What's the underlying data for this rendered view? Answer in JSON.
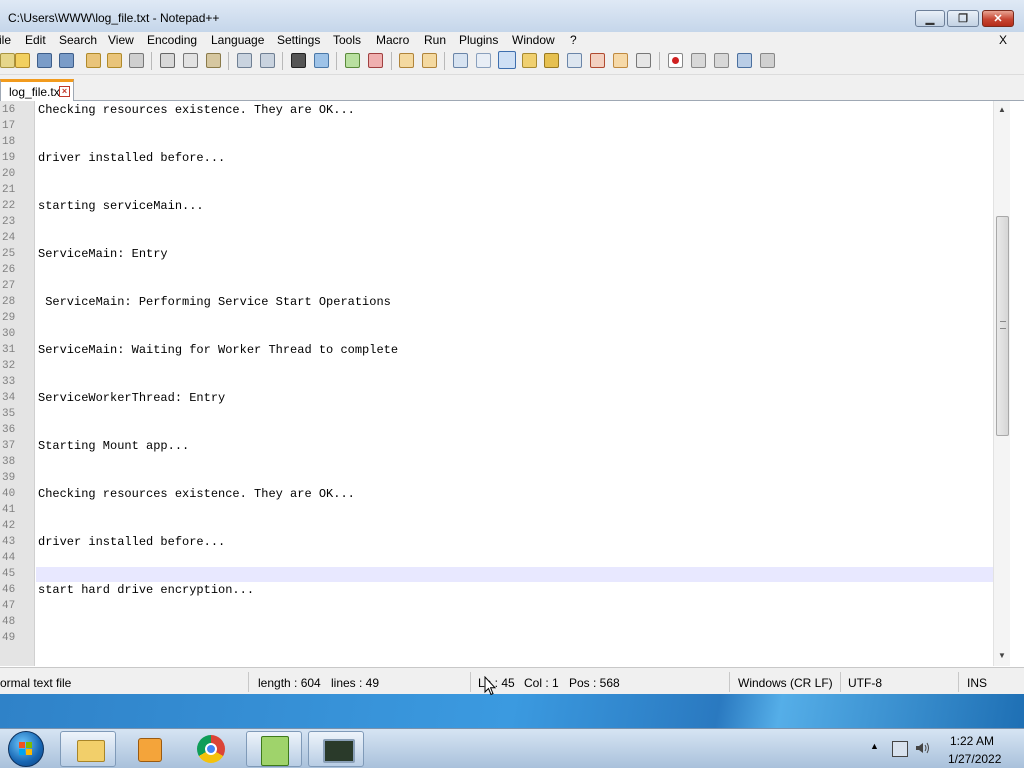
{
  "window": {
    "title": "C:\\Users\\WWW\\log_file.txt - Notepad++"
  },
  "menu": {
    "items": [
      "ile",
      "Edit",
      "Search",
      "View",
      "Encoding",
      "Language",
      "Settings",
      "Tools",
      "Macro",
      "Run",
      "Plugins",
      "Window",
      "?"
    ],
    "close_label": "X"
  },
  "tab": {
    "label": "log_file.txt"
  },
  "editor": {
    "line_numbers": [
      "16",
      "17",
      "18",
      "19",
      "20",
      "21",
      "22",
      "23",
      "24",
      "25",
      "26",
      "27",
      "28",
      "29",
      "30",
      "31",
      "32",
      "33",
      "34",
      "35",
      "36",
      "37",
      "38",
      "39",
      "40",
      "41",
      "42",
      "43",
      "44",
      "45",
      "46",
      "47",
      "48",
      "49"
    ],
    "lines": [
      "Checking resources existence. They are OK...",
      "",
      "",
      "driver installed before...",
      "",
      "",
      "starting serviceMain...",
      "",
      "",
      "ServiceMain: Entry",
      "",
      "",
      " ServiceMain: Performing Service Start Operations",
      "",
      "",
      "ServiceMain: Waiting for Worker Thread to complete",
      "",
      "",
      "ServiceWorkerThread: Entry",
      "",
      "",
      "Starting Mount app...",
      "",
      "",
      "Checking resources existence. They are OK...",
      "",
      "",
      "driver installed before...",
      "",
      "",
      "start hard drive encryption...",
      "",
      "",
      ""
    ],
    "current_line": "45"
  },
  "status": {
    "file_type": "ormal text file",
    "length": "length : 604",
    "lines": "lines : 49",
    "ln": "Ln : 45",
    "col": "Col : 1",
    "pos": "Pos : 568",
    "eol": "Windows (CR LF)",
    "encoding": "UTF-8",
    "mode": "INS"
  },
  "taskbar": {
    "time": "1:22 AM",
    "date": "1/27/2022"
  }
}
